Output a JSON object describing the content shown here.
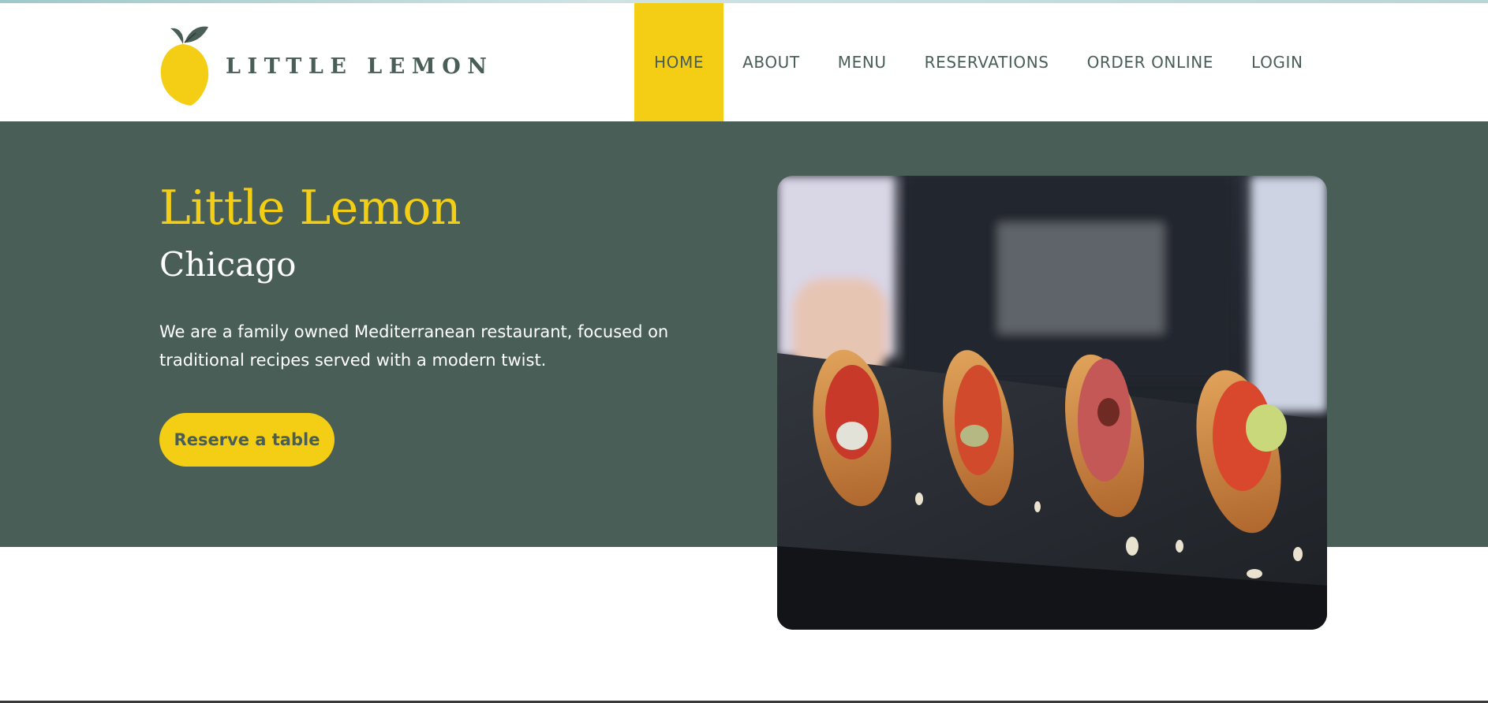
{
  "brand": {
    "name": "LITTLE LEMON",
    "logo_icon": "lemon-icon"
  },
  "nav": {
    "items": [
      {
        "label": "HOME",
        "active": true
      },
      {
        "label": "ABOUT",
        "active": false
      },
      {
        "label": "MENU",
        "active": false
      },
      {
        "label": "RESERVATIONS",
        "active": false
      },
      {
        "label": "ORDER ONLINE",
        "active": false
      },
      {
        "label": "LOGIN",
        "active": false
      }
    ]
  },
  "hero": {
    "title": "Little Lemon",
    "subtitle": "Chicago",
    "description": "We are a family owned Mediterranean restaurant, focused on traditional recipes served with a modern twist.",
    "cta_label": "Reserve a table",
    "image": "hero-food-photo"
  },
  "colors": {
    "primary_green": "#495e57",
    "primary_yellow": "#f4ce14",
    "white": "#ffffff"
  }
}
